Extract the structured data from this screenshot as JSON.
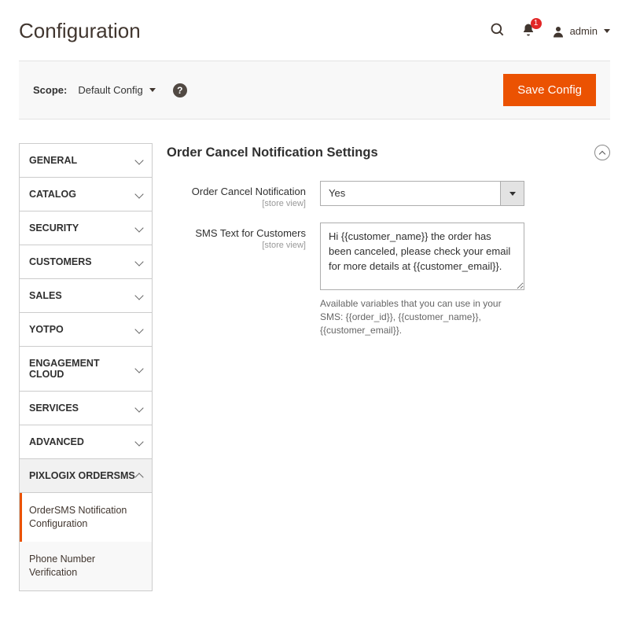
{
  "header": {
    "title": "Configuration",
    "notification_count": "1",
    "admin_label": "admin"
  },
  "scopebar": {
    "label": "Scope:",
    "value": "Default Config",
    "save_label": "Save Config"
  },
  "sidebar": {
    "items": [
      {
        "label": "GENERAL"
      },
      {
        "label": "CATALOG"
      },
      {
        "label": "SECURITY"
      },
      {
        "label": "CUSTOMERS"
      },
      {
        "label": "SALES"
      },
      {
        "label": "YOTPO"
      },
      {
        "label": "ENGAGEMENT CLOUD"
      },
      {
        "label": "SERVICES"
      },
      {
        "label": "ADVANCED"
      },
      {
        "label": "PIXLOGIX ORDERSMS"
      }
    ],
    "sub": [
      {
        "label": "OrderSMS Notification Configuration"
      },
      {
        "label": "Phone Number Verification"
      }
    ]
  },
  "section": {
    "title": "Order Cancel Notification Settings",
    "fields": {
      "enable": {
        "label": "Order Cancel Notification",
        "scope": "[store view]",
        "value": "Yes"
      },
      "sms": {
        "label": "SMS Text for Customers",
        "scope": "[store view]",
        "value": "Hi {{customer_name}} the order has been canceled, please check your email for more details at {{customer_email}}.",
        "hint": "Available variables that you can use in your SMS: {{order_id}}, {{customer_name}}, {{customer_email}}."
      }
    }
  }
}
